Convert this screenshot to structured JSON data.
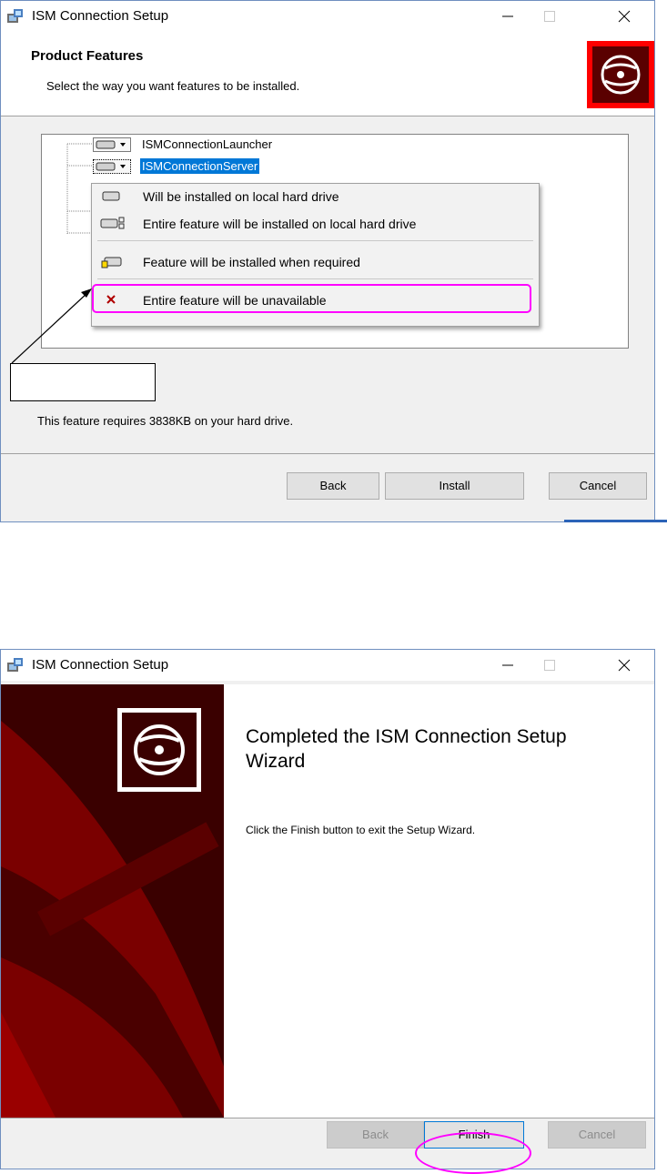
{
  "window1": {
    "title": "ISM Connection Setup",
    "header_title": "Product Features",
    "header_subtitle": "Select the way you want features to be installed.",
    "features": [
      "ISMConnectionLauncher",
      "ISMConnectionServer"
    ],
    "menu_items": [
      {
        "label": "Will be installed on local hard drive",
        "icon": "hard-drive-icon"
      },
      {
        "label": "Entire feature will be installed on local hard drive",
        "icon": "hard-drive-entire-icon"
      },
      {
        "label": "Feature will be installed when required",
        "icon": "install-on-demand-icon"
      },
      {
        "label": "Entire feature will be unavailable",
        "icon": "unavailable-x-icon"
      }
    ],
    "requirement_text": "This feature requires 3838KB on your hard drive.",
    "buttons": {
      "back": "Back",
      "install": "Install",
      "cancel": "Cancel"
    }
  },
  "window2": {
    "title": "ISM Connection Setup",
    "completed_title": "Completed the ISM Connection Setup Wizard",
    "finish_text": "Click the Finish button to exit the Setup Wizard.",
    "buttons": {
      "back": "Back",
      "finish": "Finish",
      "cancel": "Cancel"
    }
  },
  "colors": {
    "highlight": "#ff00ff",
    "selection": "#0078d7",
    "brand_dark": "#5a0000",
    "brand_red": "#ff0000"
  }
}
